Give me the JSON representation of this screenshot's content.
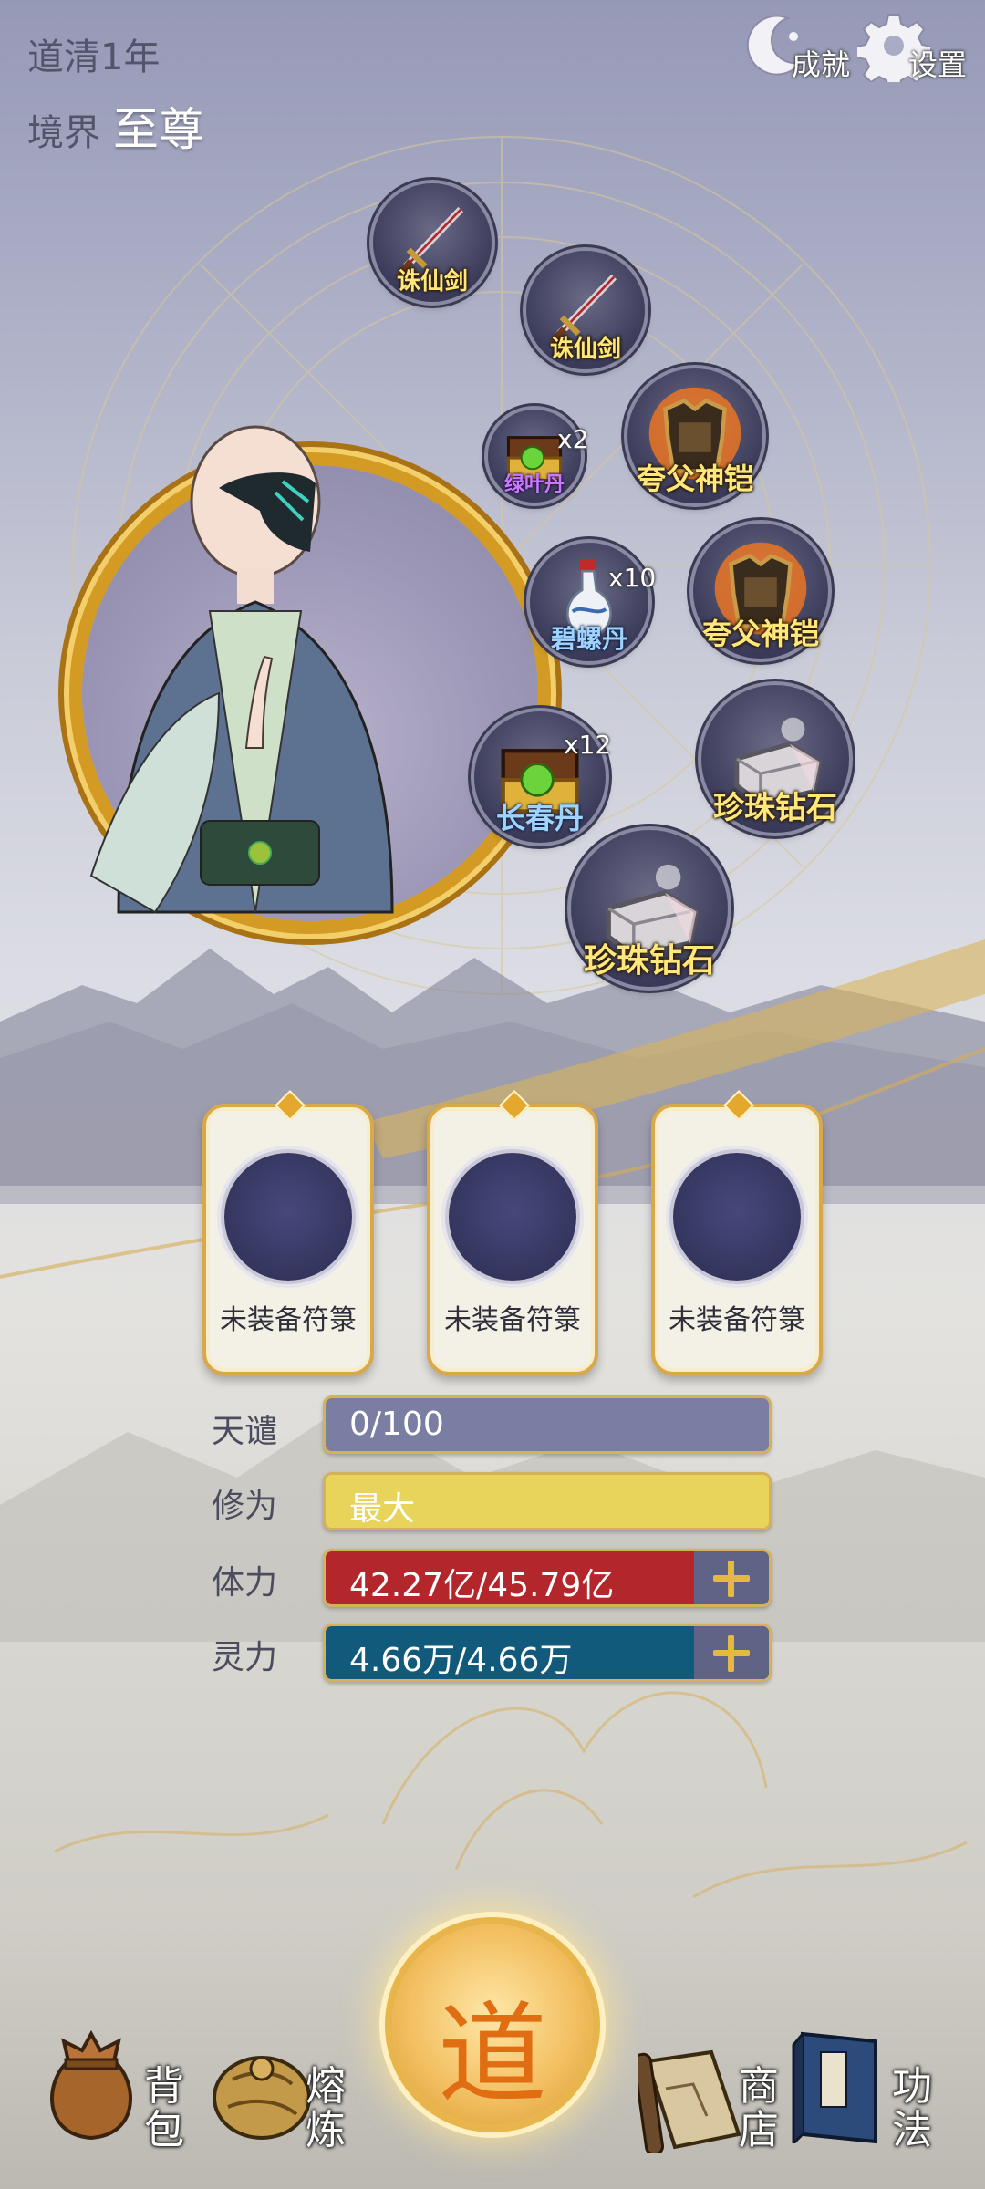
{
  "status": {
    "year": "道清1年",
    "realm_label": "境界",
    "realm_value": "至尊"
  },
  "top_buttons": {
    "achievements": "成就",
    "settings": "设置"
  },
  "items": [
    {
      "name": "诛仙剑",
      "qty": "",
      "kind": "sword"
    },
    {
      "name": "诛仙剑",
      "qty": "",
      "kind": "sword"
    },
    {
      "name": "绿叶丹",
      "qty": "x2",
      "kind": "chest"
    },
    {
      "name": "夸父神铠",
      "qty": "",
      "kind": "armor"
    },
    {
      "name": "碧螺丹",
      "qty": "x10",
      "kind": "vase"
    },
    {
      "name": "夸父神铠",
      "qty": "",
      "kind": "armor"
    },
    {
      "name": "长春丹",
      "qty": "x12",
      "kind": "chest"
    },
    {
      "name": "珍珠钻石",
      "qty": "",
      "kind": "ore"
    },
    {
      "name": "珍珠钻石",
      "qty": "",
      "kind": "ore"
    }
  ],
  "talismans": [
    {
      "label": "未装备符箓"
    },
    {
      "label": "未装备符箓"
    },
    {
      "label": "未装备符箓"
    }
  ],
  "stats": [
    {
      "label": "天谴",
      "value": "0/100",
      "fill": 0.0,
      "color": "#7a7ea3",
      "plus": false
    },
    {
      "label": "修为",
      "value": "最大",
      "fill": 1.0,
      "color": "#e8d45a",
      "plus": false
    },
    {
      "label": "体力",
      "value": "42.27亿/45.79亿",
      "fill": 0.92,
      "color": "#b3262b",
      "plus": true
    },
    {
      "label": "灵力",
      "value": "4.66万/4.66万",
      "fill": 1.0,
      "color": "#125a7c",
      "plus": true
    }
  ],
  "nav": {
    "bag": "背包",
    "refine": "熔炼",
    "dao": "道",
    "shop": "商店",
    "skills": "功法"
  }
}
